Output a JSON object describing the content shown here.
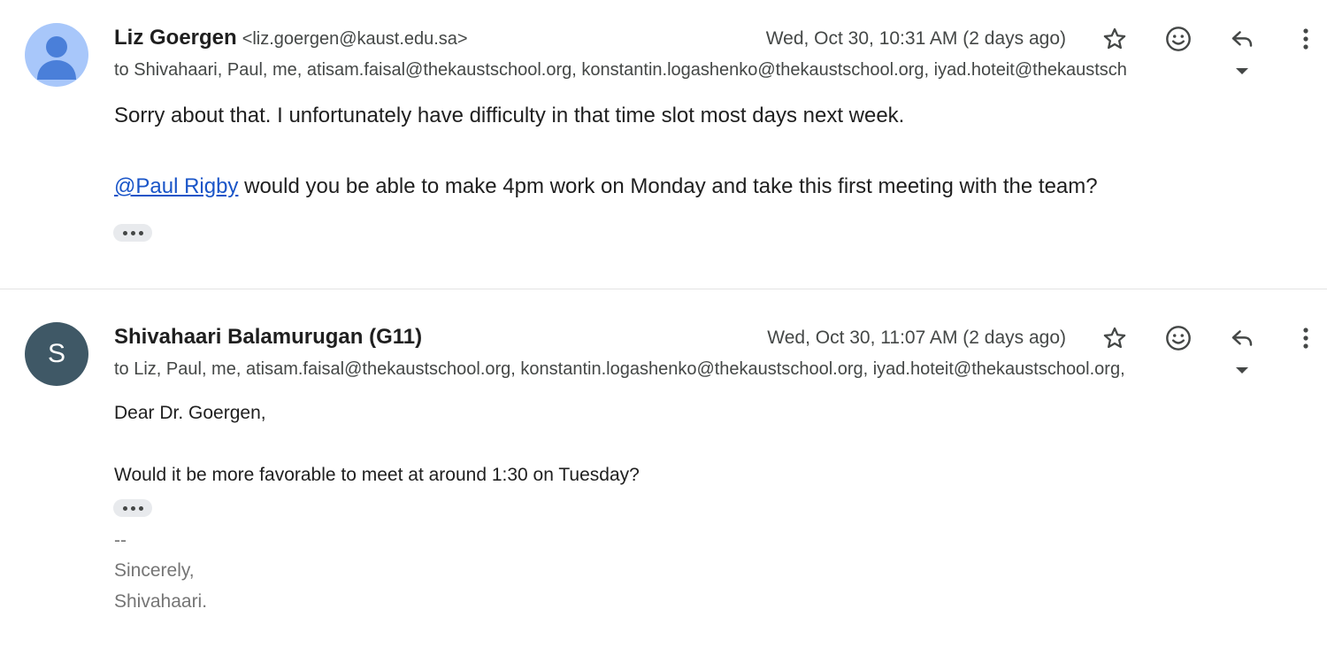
{
  "messages": [
    {
      "sender_name": "Liz Goergen",
      "sender_email": "<liz.goergen@kaust.edu.sa>",
      "date": "Wed, Oct 30, 10:31 AM (2 days ago)",
      "recipients": "to Shivahaari, Paul, me, atisam.faisal@thekaustschool.org, konstantin.logashenko@thekaustschool.org, iyad.hoteit@thekaustsch",
      "body": {
        "line1": "Sorry about that.  I unfortunately have difficulty in that time slot most days next week.",
        "mention": "@Paul Rigby",
        "line2_rest": " would you be able to make 4pm work on Monday and take this first meeting with the team?"
      }
    },
    {
      "sender_name": "Shivahaari Balamurugan (G11)",
      "avatar_letter": "S",
      "date": "Wed, Oct 30, 11:07 AM (2 days ago)",
      "recipients": "to Liz, Paul, me, atisam.faisal@thekaustschool.org, konstantin.logashenko@thekaustschool.org, iyad.hoteit@thekaustschool.org,",
      "body": {
        "greeting": "Dear Dr. Goergen,",
        "line1": "Would it be more favorable to meet at around 1:30 on Tuesday?"
      },
      "signature": {
        "dash": "--",
        "closing": "Sincerely,",
        "name": "Shivahaari."
      }
    }
  ],
  "icons": [
    "star-icon",
    "emoji-icon",
    "reply-icon",
    "more-vert-icon",
    "caret-down-icon",
    "ellipsis-icon"
  ],
  "colors": {
    "link": "#1a55c8",
    "avatar_liz": "#a8c7fa",
    "avatar_person": "#4a7fd9",
    "avatar_s": "#3f5866",
    "signature": "#757575",
    "meta": "#444746"
  }
}
